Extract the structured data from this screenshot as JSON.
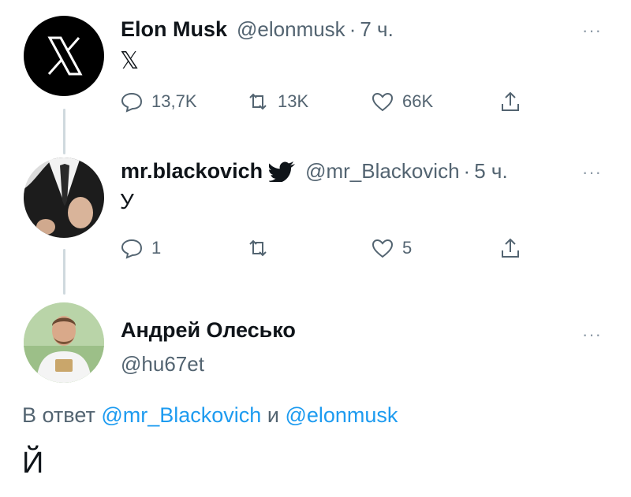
{
  "tweets": [
    {
      "name": "Elon Musk",
      "handle": "@elonmusk",
      "sep": "·",
      "time": "7 ч.",
      "text": "𝕏",
      "replies": "13,7K",
      "retweets": "13K",
      "likes": "66K"
    },
    {
      "name": "mr.blackovich",
      "handle": "@mr_Blackovich",
      "sep": "·",
      "time": "5 ч.",
      "text": "У",
      "replies": "1",
      "retweets": "",
      "likes": "5"
    }
  ],
  "main_tweet": {
    "name": "Андрей Олесько",
    "handle": "@hu67et",
    "reply_prefix": "В ответ",
    "reply_mention_1": "@mr_Blackovich",
    "reply_conj": "и",
    "reply_mention_2": "@elonmusk",
    "text": "Й"
  },
  "more_icon": "···",
  "icons": [
    "x-logo-icon",
    "verified-bird-icon",
    "reply-icon",
    "retweet-icon",
    "like-icon",
    "share-icon",
    "more-icon"
  ]
}
